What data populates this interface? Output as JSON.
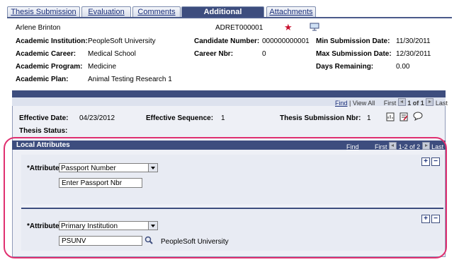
{
  "tabs": [
    {
      "label": "Thesis Submission",
      "active": false
    },
    {
      "label": "Evaluation",
      "active": false
    },
    {
      "label": "Comments",
      "active": false
    },
    {
      "label": "Additional Information",
      "active": true
    },
    {
      "label": "Attachments",
      "active": false
    }
  ],
  "header": {
    "person_name": "Arlene Brinton",
    "id": "ADRET000001"
  },
  "fields": {
    "academic_institution": {
      "label": "Academic Institution:",
      "value": "PeopleSoft University"
    },
    "academic_career": {
      "label": "Academic Career:",
      "value": "Medical School"
    },
    "academic_program": {
      "label": "Academic Program:",
      "value": "Medicine"
    },
    "academic_plan": {
      "label": "Academic Plan:",
      "value": "Animal Testing Research 1"
    },
    "candidate_number": {
      "label": "Candidate Number:",
      "value": "000000000001"
    },
    "career_nbr": {
      "label": "Career Nbr:",
      "value": "0"
    },
    "min_submission_date": {
      "label": "Min Submission Date:",
      "value": "11/30/2011"
    },
    "max_submission_date": {
      "label": "Max Submission Date:",
      "value": "12/30/2011"
    },
    "days_remaining": {
      "label": "Days Remaining:",
      "value": "0.00"
    }
  },
  "grid": {
    "nav": {
      "find": "Find",
      "view_all": "View All",
      "first": "First",
      "range": "1 of 1",
      "last": "Last"
    },
    "effective_date": {
      "label": "Effective Date:",
      "value": "04/23/2012"
    },
    "effective_sequence": {
      "label": "Effective Sequence:",
      "value": "1"
    },
    "thesis_submission_nbr": {
      "label": "Thesis Submission Nbr:",
      "value": "1"
    },
    "thesis_status": {
      "label": "Thesis Status:",
      "value": ""
    }
  },
  "local_attributes": {
    "title": "Local Attributes",
    "nav": {
      "find": "Find",
      "first": "First",
      "range": "1-2 of 2",
      "last": "Last"
    },
    "rows": [
      {
        "attribute_label": "*Attribute",
        "attribute_value": "Passport Number",
        "field_value": "Enter Passport Nbr",
        "description": ""
      },
      {
        "attribute_label": "*Attribute",
        "attribute_value": "Primary Institution",
        "field_value": "PSUNV",
        "description": "PeopleSoft University"
      }
    ],
    "add_label": "+",
    "remove_label": "−"
  },
  "colors": {
    "accent": "#3d4d7e",
    "highlight": "#e03070",
    "star": "#c8102e"
  }
}
